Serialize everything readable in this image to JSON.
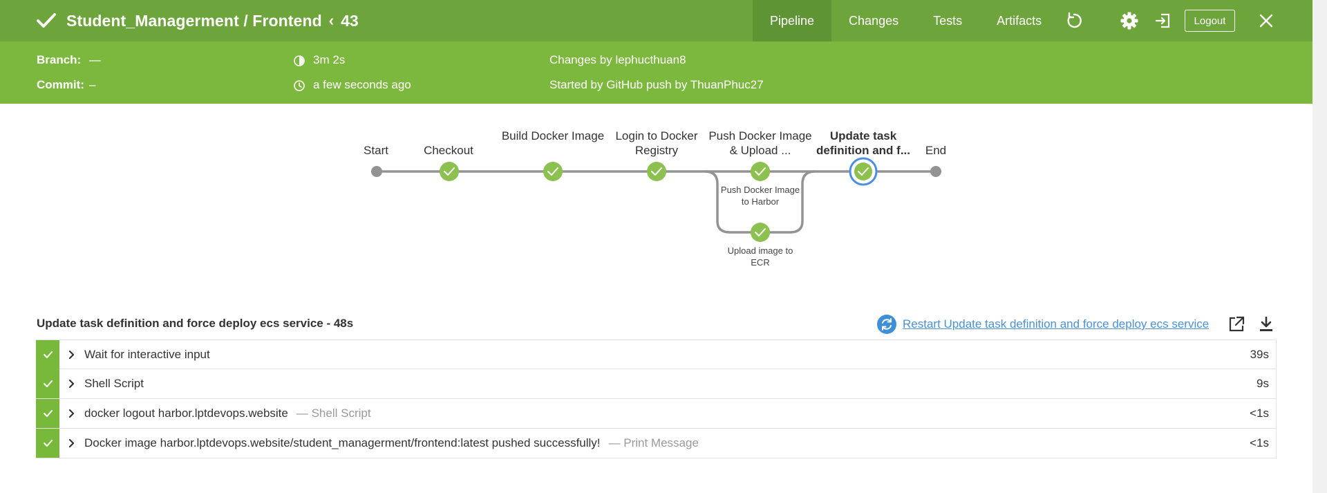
{
  "header": {
    "project": "Student_Managerment / Frontend",
    "run_number": "43",
    "tabs": [
      "Pipeline",
      "Changes",
      "Tests",
      "Artifacts"
    ],
    "active_tab": "Pipeline",
    "logout_label": "Logout",
    "colors": {
      "header_bg": "#6da53c",
      "subheader_bg": "#7cb83e",
      "active_tab_bg": "#5f9434"
    }
  },
  "info": {
    "branch_label": "Branch:",
    "branch_value": "—",
    "commit_label": "Commit:",
    "commit_value": "–",
    "duration": "3m 2s",
    "started_ago": "a few seconds ago",
    "changes_by": "Changes by lephucthuan8",
    "started_by": "Started by GitHub push by ThuanPhuc27"
  },
  "pipeline": {
    "stages": [
      {
        "label": "Start",
        "status": "none"
      },
      {
        "label": "Checkout",
        "status": "success"
      },
      {
        "label": "Build Docker Image",
        "status": "success"
      },
      {
        "label": "Login to Docker Registry",
        "status": "success"
      },
      {
        "label": "Push Docker Image & Upload ...",
        "status": "success"
      },
      {
        "label": "Update task definition and f...",
        "status": "success",
        "selected": true
      },
      {
        "label": "End",
        "status": "none"
      }
    ],
    "parallel": [
      {
        "label": "Push Docker Image to Harbor",
        "status": "success"
      },
      {
        "label": "Upload image to ECR",
        "status": "success"
      }
    ],
    "colors": {
      "success": "#8cc04f",
      "line": "#949393",
      "selected_ring": "#4a90e2"
    }
  },
  "stage_detail": {
    "title": "Update task definition and force deploy ecs service - 48s",
    "restart_label": "Restart Update task definition and force deploy ecs service",
    "steps": [
      {
        "name": "Wait for interactive input",
        "sub": "",
        "duration": "39s"
      },
      {
        "name": "Shell Script",
        "sub": "",
        "duration": "9s"
      },
      {
        "name": "docker logout harbor.lptdevops.website",
        "sub": "— Shell Script",
        "duration": "<1s"
      },
      {
        "name": "Docker image harbor.lptdevops.website/student_managerment/frontend:latest pushed successfully!",
        "sub": "— Print Message",
        "duration": "<1s"
      }
    ]
  }
}
